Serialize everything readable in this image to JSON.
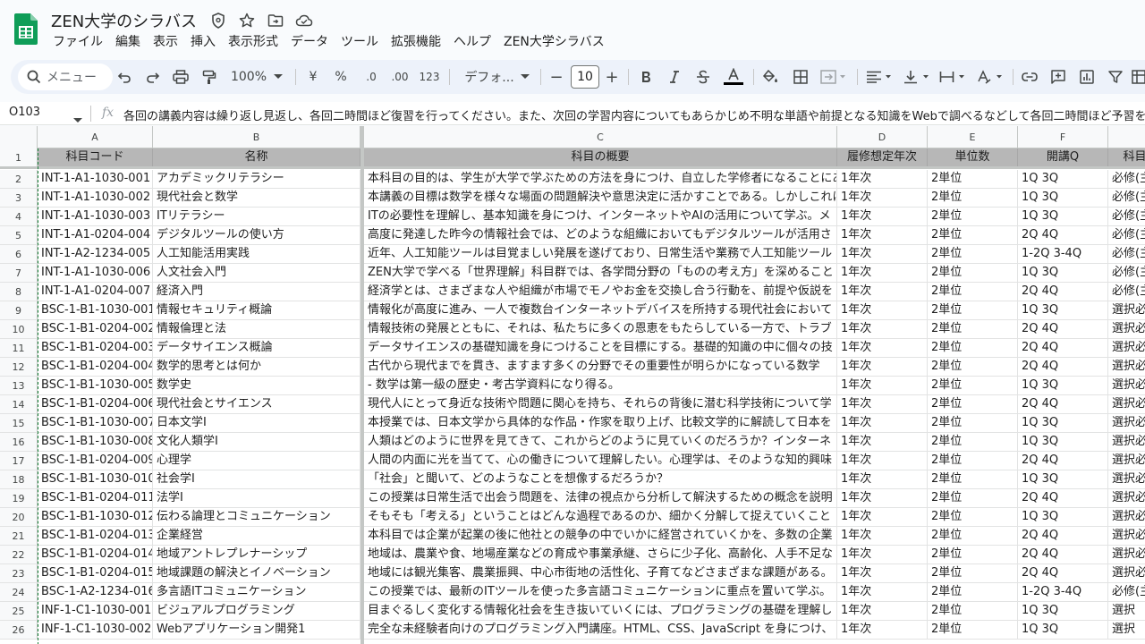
{
  "app": {
    "title": "ZEN大学のシラバス",
    "menus": [
      "ファイル",
      "編集",
      "表示",
      "挿入",
      "表示形式",
      "データ",
      "ツール",
      "拡張機能",
      "ヘルプ",
      "ZEN大学シラバス"
    ]
  },
  "toolbar": {
    "search_placeholder": "メニュー",
    "zoom": "100%",
    "currency": "¥",
    "percent": "%",
    "decrease_decimal": ".0",
    "increase_decimal": ".00",
    "number_format": "123",
    "font": "デフォ...",
    "font_size": "10",
    "minus": "−",
    "plus": "+"
  },
  "formula_bar": {
    "cell_ref": "O103",
    "fx": "fx",
    "content": "各回の講義内容は繰り返し見返し、各回二時間ほど復習を行ってください。また、次回の学習内容についてもあらかじめ不明な単語や前提となる知識をWebで調べるなどして各回二時間ほど予習を行ってください。"
  },
  "columns": [
    "A",
    "B",
    "C",
    "D",
    "E",
    "F",
    ""
  ],
  "header_row": {
    "num": "1",
    "cells": [
      "科目コード",
      "名称",
      "科目の概要",
      "履修想定年次",
      "単位数",
      "開講Q",
      "科目"
    ]
  },
  "rows": [
    {
      "num": "2",
      "cells": [
        "INT-1-A1-1030-001",
        "アカデミックリテラシー",
        "本科目の目的は、学生が大学で学ぶための方法を身につけ、自立した学修者になることにある。",
        "1年次",
        "2単位",
        "1Q 3Q",
        "必修(主"
      ]
    },
    {
      "num": "3",
      "cells": [
        "INT-1-A1-1030-002",
        "現代社会と数学",
        "本講義の目標は数学を様々な場面の問題解決や意思決定に活かすことである。しかしこれは",
        "1年次",
        "2単位",
        "1Q 3Q",
        "必修(主"
      ]
    },
    {
      "num": "4",
      "cells": [
        "INT-1-A1-1030-003",
        "ITリテラシー",
        "ITの必要性を理解し、基本知識を身につけ、インターネットやAIの活用について学ぶ。メ",
        "1年次",
        "2単位",
        "1Q 3Q",
        "必修(主"
      ]
    },
    {
      "num": "5",
      "cells": [
        "INT-1-A1-0204-004",
        "デジタルツールの使い方",
        "高度に発達した昨今の情報社会では、どのような組織においてもデジタルツールが活用さ",
        "1年次",
        "2単位",
        "2Q 4Q",
        "必修(主"
      ]
    },
    {
      "num": "6",
      "cells": [
        "INT-1-A2-1234-005",
        "人工知能活用実践",
        "近年、人工知能ツールは目覚ましい発展を遂げており、日常生活や業務で人工知能ツール",
        "1年次",
        "2単位",
        "1-2Q 3-4Q",
        "必修(主"
      ]
    },
    {
      "num": "7",
      "cells": [
        "INT-1-A1-1030-006",
        "人文社会入門",
        "ZEN大学で学べる「世界理解」科目群では、各学問分野の「ものの考え方」を深めること",
        "1年次",
        "2単位",
        "1Q 3Q",
        "必修(主"
      ]
    },
    {
      "num": "8",
      "cells": [
        "INT-1-A1-0204-007",
        "経済入門",
        "経済学とは、さまざまな人や組織が市場でモノやお金を交換し合う行動を、前提や仮説を",
        "1年次",
        "2単位",
        "2Q 4Q",
        "必修(主"
      ]
    },
    {
      "num": "9",
      "cells": [
        "BSC-1-B1-1030-001",
        "情報セキュリティ概論",
        "情報化が高度に進み、一人で複数台インターネットデバイスを所持する現代社会において",
        "1年次",
        "2単位",
        "1Q 3Q",
        "選択必"
      ]
    },
    {
      "num": "10",
      "cells": [
        "BSC-1-B1-0204-002",
        "情報倫理と法",
        "情報技術の発展とともに、それは、私たちに多くの恩恵をもたらしている一方で、トラブ",
        "1年次",
        "2単位",
        "2Q 4Q",
        "選択必"
      ]
    },
    {
      "num": "11",
      "cells": [
        "BSC-1-B1-0204-003",
        "データサイエンス概論",
        "データサイエンスの基礎知識を身につけることを目標にする。基礎的知識の中に個々の技",
        "1年次",
        "2単位",
        "2Q 4Q",
        "選択必"
      ]
    },
    {
      "num": "12",
      "cells": [
        "BSC-1-B1-0204-004",
        "数学的思考とは何か",
        "古代から現代までを貫き、ますます多くの分野でその重要性が明らかになっている数学",
        "1年次",
        "2単位",
        "2Q 4Q",
        "選択必"
      ]
    },
    {
      "num": "13",
      "cells": [
        "BSC-1-B1-1030-005",
        "数学史",
        "- 数学は第一級の歴史・考古学資料になり得る。",
        "1年次",
        "2単位",
        "1Q 3Q",
        "選択必"
      ]
    },
    {
      "num": "14",
      "cells": [
        "BSC-1-B1-0204-006",
        "現代社会とサイエンス",
        "現代人にとって身近な技術や問題に関心を持ち、それらの背後に潜む科学技術について学",
        "1年次",
        "2単位",
        "2Q 4Q",
        "選択必"
      ]
    },
    {
      "num": "15",
      "cells": [
        "BSC-1-B1-1030-007",
        "日本文学Ⅰ",
        "本授業では、日本文学から具体的な作品・作家を取り上げ、比較文学的に解読して日本を",
        "1年次",
        "2単位",
        "1Q 3Q",
        "選択必"
      ]
    },
    {
      "num": "16",
      "cells": [
        "BSC-1-B1-1030-008",
        "文化人類学Ⅰ",
        "人類はどのように世界を見てきて、これからどのように見ていくのだろうか？インターネ",
        "1年次",
        "2単位",
        "1Q 3Q",
        "選択必"
      ]
    },
    {
      "num": "17",
      "cells": [
        "BSC-1-B1-0204-009",
        "心理学",
        "人間の内面に光を当てて、心の働きについて理解したい。心理学は、そのような知的興味",
        "1年次",
        "2単位",
        "2Q 4Q",
        "選択必"
      ]
    },
    {
      "num": "18",
      "cells": [
        "BSC-1-B1-1030-010",
        "社会学Ⅰ",
        "「社会」と聞いて、どのようなことを想像するだろうか？",
        "1年次",
        "2単位",
        "1Q 3Q",
        "選択必"
      ]
    },
    {
      "num": "19",
      "cells": [
        "BSC-1-B1-0204-011",
        "法学Ⅰ",
        "この授業は日常生活で出会う問題を、法律の視点から分析して解決するための概念を説明",
        "1年次",
        "2単位",
        "2Q 4Q",
        "選択必"
      ]
    },
    {
      "num": "20",
      "cells": [
        "BSC-1-B1-1030-012",
        "伝わる論理とコミュニケーション",
        "そもそも「考える」ということはどんな過程であるのか、細かく分解して捉えていくこと",
        "1年次",
        "2単位",
        "1Q 3Q",
        "選択必"
      ]
    },
    {
      "num": "21",
      "cells": [
        "BSC-1-B1-0204-013",
        "企業経営",
        "本科目では企業が起業の後に他社との競争の中でいかに経営されていくかを、多数の企業",
        "1年次",
        "2単位",
        "2Q 4Q",
        "選択必"
      ]
    },
    {
      "num": "22",
      "cells": [
        "BSC-1-B1-0204-014",
        "地域アントレプレナーシップ",
        "地域は、農業や食、地場産業などの育成や事業承継、さらに少子化、高齢化、人手不足な",
        "1年次",
        "2単位",
        "2Q 4Q",
        "選択必"
      ]
    },
    {
      "num": "23",
      "cells": [
        "BSC-1-B1-0204-015",
        "地域課題の解決とイノベーション",
        "地域には観光集客、農業振興、中心市街地の活性化、子育てなどさまざまな課題がある。",
        "1年次",
        "2単位",
        "2Q 4Q",
        "選択必"
      ]
    },
    {
      "num": "24",
      "cells": [
        "BSC-1-A2-1234-016",
        "多言語ITコミュニケーション",
        "この授業では、最新のITツールを使った多言語コミュニケーションに重点を置いて学ぶ。",
        "1年次",
        "2単位",
        "1-2Q 3-4Q",
        "必修(主"
      ]
    },
    {
      "num": "25",
      "cells": [
        "INF-1-C1-1030-001",
        "ビジュアルプログラミング",
        "目まぐるしく変化する情報化社会を生き抜いていくには、プログラミングの基礎を理解し",
        "1年次",
        "2単位",
        "1Q 3Q",
        "選択"
      ]
    },
    {
      "num": "26",
      "cells": [
        "INF-1-C1-1030-002",
        "Webアプリケーション開発1",
        "完全な未経験者向けのプログラミング入門講座。HTML、CSS、JavaScript を身につけ、",
        "1年次",
        "2単位",
        "1Q 3Q",
        "選択"
      ]
    }
  ],
  "colors": {
    "sheets_green": "#0f9d58",
    "header_fill": "#b7b7b7",
    "toolbar_bg": "#edf2fa"
  }
}
